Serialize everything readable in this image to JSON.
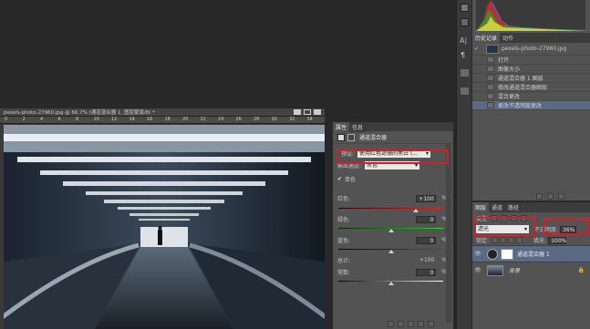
{
  "document": {
    "tab_title": "pexels-photo-27960.jpg @ 66.7% (通道混合器 1, 图层蒙版/8) *",
    "ruler_marks": [
      "0",
      "2",
      "4",
      "6",
      "8",
      "10",
      "12",
      "14",
      "16",
      "18",
      "20",
      "22",
      "24",
      "26",
      "28",
      "30",
      "32",
      "34"
    ]
  },
  "properties": {
    "tabs": [
      "属性",
      "信息"
    ],
    "title": "通道混合器",
    "preset_label": "预设:",
    "preset_value": "使用红色滤镜的黑白 (...",
    "output_label": "输出通道:",
    "output_value": "灰色",
    "mono_label": "单色",
    "red_label": "红色:",
    "red_value": "+100",
    "green_label": "绿色:",
    "green_value": "0",
    "blue_label": "蓝色:",
    "blue_value": "0",
    "total_label": "总计:",
    "total_value": "+100",
    "constant_label": "常数:",
    "constant_value": "0",
    "percent": "%"
  },
  "history": {
    "tabs": [
      "历史记录",
      "动作"
    ],
    "snapshot": "pexels-photo-27960.jpg",
    "items": [
      "打开",
      "图像大小",
      "通道混合器 1 图层",
      "修改通道混合器图层",
      "混合更改",
      "更改不透明度更改"
    ]
  },
  "layers": {
    "tabs": [
      "图层",
      "通道",
      "路径"
    ],
    "kind_label": "类型",
    "blend_mode": "滤光",
    "opacity_label": "不透明度:",
    "opacity_value": "36%",
    "lock_label": "锁定:",
    "fill_label": "填充:",
    "fill_value": "100%",
    "items": [
      {
        "name": "通道混合器 1"
      },
      {
        "name": "背景"
      }
    ]
  },
  "colors": {
    "highlight": "#d1202a",
    "history_selected": "#5a6a85"
  }
}
